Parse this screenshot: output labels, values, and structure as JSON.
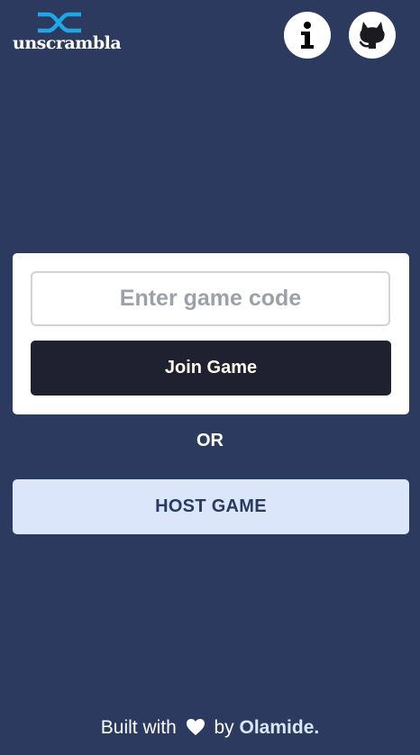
{
  "header": {
    "logo_text": "unscrambla",
    "logo_mark_icon": "shuffle-icon",
    "info_icon": "info-icon",
    "github_icon": "github-icon",
    "brand_color": "#1ea7e4"
  },
  "join": {
    "placeholder": "Enter game code",
    "value": "",
    "button_label": "Join Game"
  },
  "divider_text": "OR",
  "host": {
    "button_label": "HOST GAME"
  },
  "footer": {
    "prefix": "Built with",
    "icon": "heart-icon",
    "by": "by",
    "author": "Olamide."
  },
  "colors": {
    "background": "#2b3a5e",
    "card": "#ffffff",
    "join_button": "#1f2130",
    "host_button": "#dbe6fb"
  }
}
